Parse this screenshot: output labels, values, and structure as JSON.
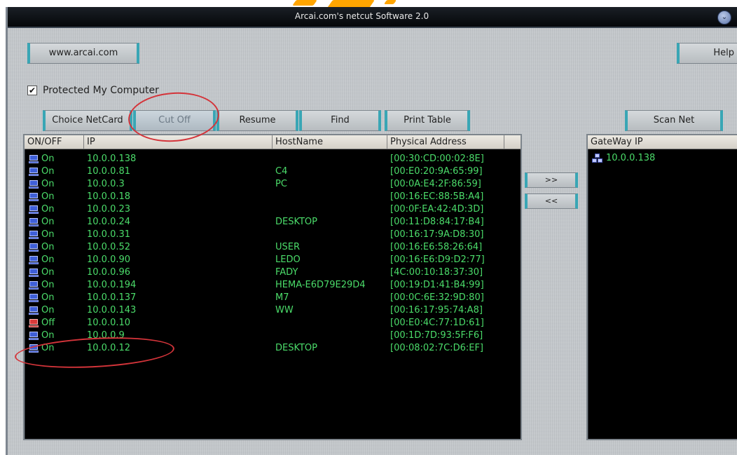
{
  "window": {
    "title": "Arcai.com's netcut Software 2.0",
    "title_button": "⌄"
  },
  "toolbar": {
    "website_label": "www.arcai.com",
    "help_label": "Help",
    "protect_checked": true,
    "protect_label": "Protected My Computer",
    "choice_netcard_label": "Choice NetCard",
    "cut_off_label": "Cut Off",
    "resume_label": "Resume",
    "find_label": "Find",
    "print_table_label": "Print Table",
    "scan_net_label": "Scan Net",
    "move_right_label": ">>",
    "move_left_label": "<<"
  },
  "hosts_table": {
    "columns": [
      "ON/OFF",
      "IP",
      "HostName",
      "Physical Address"
    ],
    "rows": [
      {
        "status": "On",
        "ip": "10.0.0.138",
        "hostname": "",
        "mac": "[00:30:CD:00:02:8E]"
      },
      {
        "status": "On",
        "ip": "10.0.0.81",
        "hostname": "C4",
        "mac": "[00:E0:20:9A:65:99]"
      },
      {
        "status": "On",
        "ip": "10.0.0.3",
        "hostname": "PC",
        "mac": "[00:0A:E4:2F:86:59]"
      },
      {
        "status": "On",
        "ip": "10.0.0.18",
        "hostname": "",
        "mac": "[00:16:EC:88:5B:A4]"
      },
      {
        "status": "On",
        "ip": "10.0.0.23",
        "hostname": "",
        "mac": "[00:0F:EA:42:4D:3D]"
      },
      {
        "status": "On",
        "ip": "10.0.0.24",
        "hostname": "DESKTOP",
        "mac": "[00:11:D8:84:17:B4]"
      },
      {
        "status": "On",
        "ip": "10.0.0.31",
        "hostname": "",
        "mac": "[00:16:17:9A:D8:30]"
      },
      {
        "status": "On",
        "ip": "10.0.0.52",
        "hostname": "USER",
        "mac": "[00:16:E6:58:26:64]"
      },
      {
        "status": "On",
        "ip": "10.0.0.90",
        "hostname": "LEDO",
        "mac": "[00:16:E6:D9:D2:77]"
      },
      {
        "status": "On",
        "ip": "10.0.0.96",
        "hostname": "FADY",
        "mac": "[4C:00:10:18:37:30]"
      },
      {
        "status": "On",
        "ip": "10.0.0.194",
        "hostname": "HEMA-E6D79E29D4",
        "mac": "[00:19:D1:41:B4:99]"
      },
      {
        "status": "On",
        "ip": "10.0.0.137",
        "hostname": "M7",
        "mac": "[00:0C:6E:32:9D:80]"
      },
      {
        "status": "On",
        "ip": "10.0.0.143",
        "hostname": "WW",
        "mac": "[00:16:17:95:74:A8]"
      },
      {
        "status": "Off",
        "ip": "10.0.0.10",
        "hostname": "",
        "mac": "[00:E0:4C:77:1D:61]"
      },
      {
        "status": "On",
        "ip": "10.0.0.9",
        "hostname": "",
        "mac": "[00:1D:7D:93:5F:F6]"
      },
      {
        "status": "On",
        "ip": "10.0.0.12",
        "hostname": "DESKTOP",
        "mac": "[00:08:02:7C:D6:EF]"
      }
    ]
  },
  "gateway_table": {
    "column": "GateWay IP",
    "rows": [
      "10.0.0.138"
    ]
  },
  "colors": {
    "row_text": "#4bdc6a",
    "highlight_ring": "#d4343a",
    "accent": "#39a6b5"
  },
  "icons": {
    "host_on": "pc-on-icon",
    "host_off": "pc-off-icon",
    "gateway": "network-icon"
  }
}
